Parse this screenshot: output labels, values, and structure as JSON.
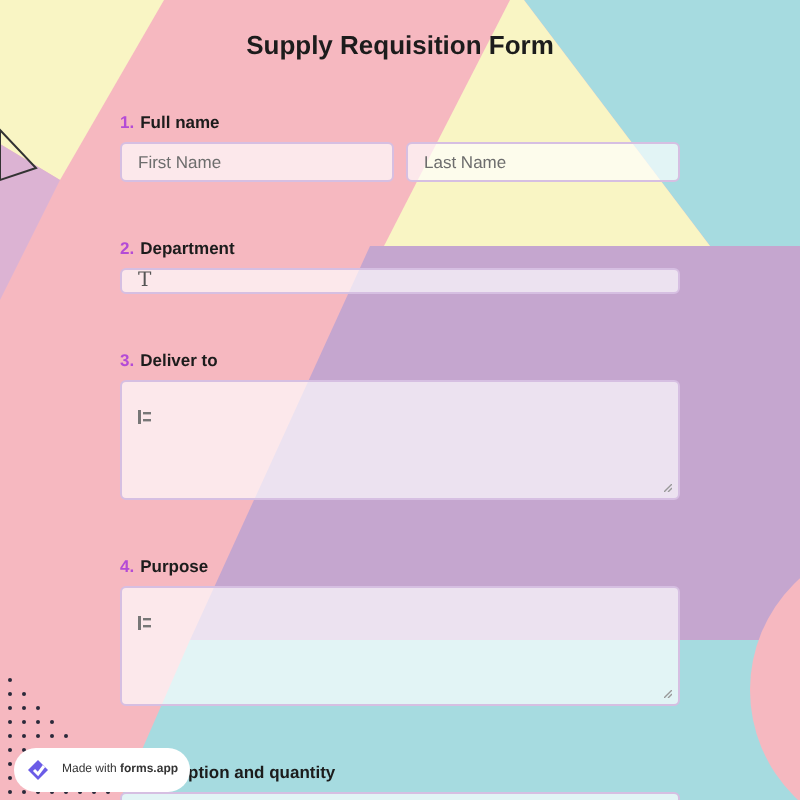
{
  "title": "Supply Requisition Form",
  "questions": [
    {
      "number": "1.",
      "label": "Full name",
      "kind": "name",
      "placeholders": [
        "First Name",
        "Last Name"
      ]
    },
    {
      "number": "2.",
      "label": "Department",
      "kind": "text",
      "icon_char": "T"
    },
    {
      "number": "3.",
      "label": "Deliver to",
      "kind": "textarea"
    },
    {
      "number": "4.",
      "label": "Purpose",
      "kind": "textarea"
    },
    {
      "label": "ption and quantity",
      "kind": "covered"
    }
  ],
  "badge": {
    "text": "Made with **forms.app**"
  }
}
